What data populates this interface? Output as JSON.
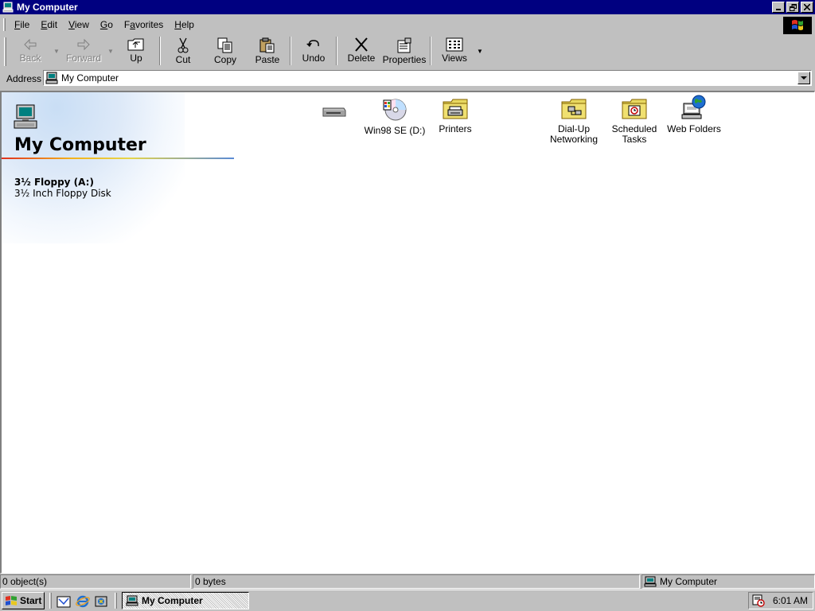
{
  "window": {
    "title": "My Computer",
    "controls": [
      "minimize",
      "restore",
      "close"
    ]
  },
  "menu": {
    "items": [
      {
        "label": "File",
        "accel": "F",
        "rest": "ile"
      },
      {
        "label": "Edit",
        "accel": "E",
        "rest": "dit"
      },
      {
        "label": "View",
        "accel": "V",
        "rest": "iew"
      },
      {
        "label": "Go",
        "accel": "G",
        "rest": "o"
      },
      {
        "label": "Favorites",
        "accel": "a",
        "pre": "F",
        "rest": "vorites"
      },
      {
        "label": "Help",
        "accel": "H",
        "rest": "elp"
      }
    ]
  },
  "toolbar": {
    "back": "Back",
    "forward": "Forward",
    "up": "Up",
    "cut": "Cut",
    "copy": "Copy",
    "paste": "Paste",
    "undo": "Undo",
    "delete": "Delete",
    "properties": "Properties",
    "views": "Views"
  },
  "address": {
    "label": "Address",
    "value": "My Computer"
  },
  "webview": {
    "title": "My Computer",
    "selected_name": "3½ Floppy (A:)",
    "selected_desc": "3½ Inch Floppy Disk"
  },
  "icons": [
    {
      "name": "floppy",
      "label": ""
    },
    {
      "name": "cdrom",
      "label": "Win98 SE (D:)"
    },
    {
      "name": "printers",
      "label": "Printers"
    },
    {
      "name": "dialup",
      "label": "Dial-Up Networking"
    },
    {
      "name": "scheduled",
      "label": "Scheduled Tasks"
    },
    {
      "name": "webfolders",
      "label": "Web Folders"
    }
  ],
  "status": {
    "objects": "0 object(s)",
    "size": "0 bytes",
    "zone": "My Computer"
  },
  "taskbar": {
    "start": "Start",
    "task": "My Computer",
    "clock": "6:01 AM"
  },
  "colors": {
    "titlebar": "#000080",
    "face": "#c0c0c0"
  }
}
